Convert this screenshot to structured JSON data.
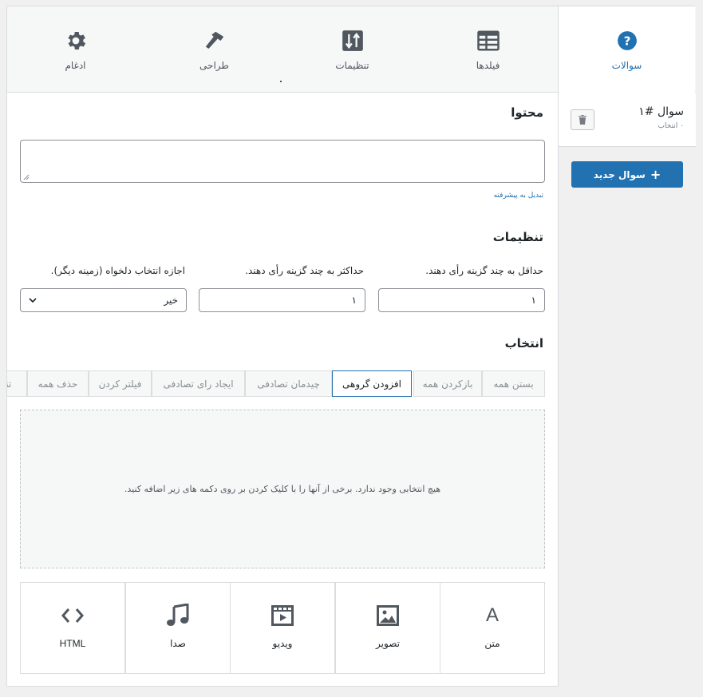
{
  "nav": {
    "items": [
      {
        "label": "سوالات",
        "icon": "question-circle-icon",
        "active": true
      },
      {
        "label": "فیلدها",
        "icon": "table-icon"
      },
      {
        "label": "تنظیمات",
        "icon": "sliders-icon"
      },
      {
        "label": "طراحی",
        "icon": "hammer-icon"
      },
      {
        "label": "ادغام",
        "icon": "gear-icon"
      }
    ]
  },
  "sidebar": {
    "question_title": "سوال #۱",
    "question_sub": "۰ انتخاب",
    "new_question": "سوال جدید"
  },
  "content": {
    "title": "محتوا",
    "advanced_link": "تبدیل به پیشرفته"
  },
  "settings": {
    "title": "تنظیمات",
    "min_label": "حداقل به چند گزینه رأی دهند.",
    "min_value": "۱",
    "max_label": "حداکثر به چند گزینه رأی دهند.",
    "max_value": "۱",
    "allow_label": "اجازه انتخاب دلخواه (زمینه دیگر).",
    "allow_value": "خیر"
  },
  "choices": {
    "title": "انتخاب",
    "toolbar": [
      "بستن همه",
      "بازکردن همه",
      "افزودن گروهی",
      "چیدمان تصادفی",
      "ایجاد رای تصادفی",
      "فیلتر کردن",
      "حذف همه",
      "تنظ"
    ],
    "empty_text": "هیچ انتخابی وجود ندارد. برخی از آنها را با کلیک کردن بر روی دکمه های زیر اضافه کنید.",
    "types": [
      {
        "label": "متن",
        "icon": "text-a-icon"
      },
      {
        "label": "تصویر",
        "icon": "image-icon"
      },
      {
        "label": "ویدیو",
        "icon": "video-icon"
      },
      {
        "label": "صدا",
        "icon": "music-note-icon"
      },
      {
        "label": "HTML",
        "icon": "code-icon"
      }
    ]
  },
  "colors": {
    "accent": "#2271b1",
    "icon_gray": "#50575e"
  }
}
